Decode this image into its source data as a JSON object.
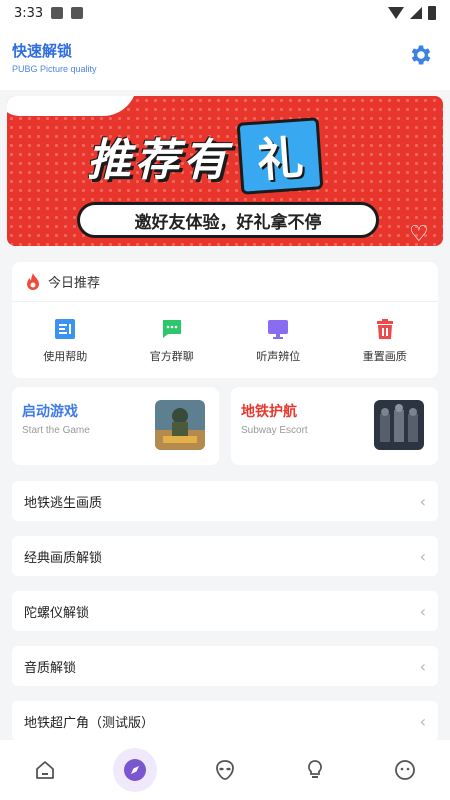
{
  "status": {
    "time": "3:33"
  },
  "header": {
    "title": "快速解锁",
    "subtitle": "PUBG Picture quality"
  },
  "banner": {
    "title": "推荐有",
    "gift_char": "礼",
    "slogan": "邀好友体验，好礼拿不停"
  },
  "recommend": {
    "heading": "今日推荐",
    "items": [
      {
        "label": "使用帮助",
        "icon": "help-doc-icon",
        "color": "#3a93f0"
      },
      {
        "label": "官方群聊",
        "icon": "chat-icon",
        "color": "#2cc76a"
      },
      {
        "label": "听声辨位",
        "icon": "monitor-icon",
        "color": "#8a6cf0"
      },
      {
        "label": "重置画质",
        "icon": "trash-icon",
        "color": "#ef4a4a"
      }
    ]
  },
  "games": [
    {
      "title": "启动游戏",
      "subtitle": "Start the Game",
      "color": "#3f7be8"
    },
    {
      "title": "地铁护航",
      "subtitle": "Subway Escort",
      "color": "#e6392f"
    }
  ],
  "list": [
    {
      "label": "地铁逃生画质"
    },
    {
      "label": "经典画质解锁"
    },
    {
      "label": "陀螺仪解锁"
    },
    {
      "label": "音质解锁"
    },
    {
      "label": "地铁超广角（测试版）"
    }
  ],
  "list_chevron": "‹",
  "colors": {
    "accent": "#2f6de1",
    "nav_active_bg": "#efe9fb",
    "nav_active": "#7a57d1"
  }
}
